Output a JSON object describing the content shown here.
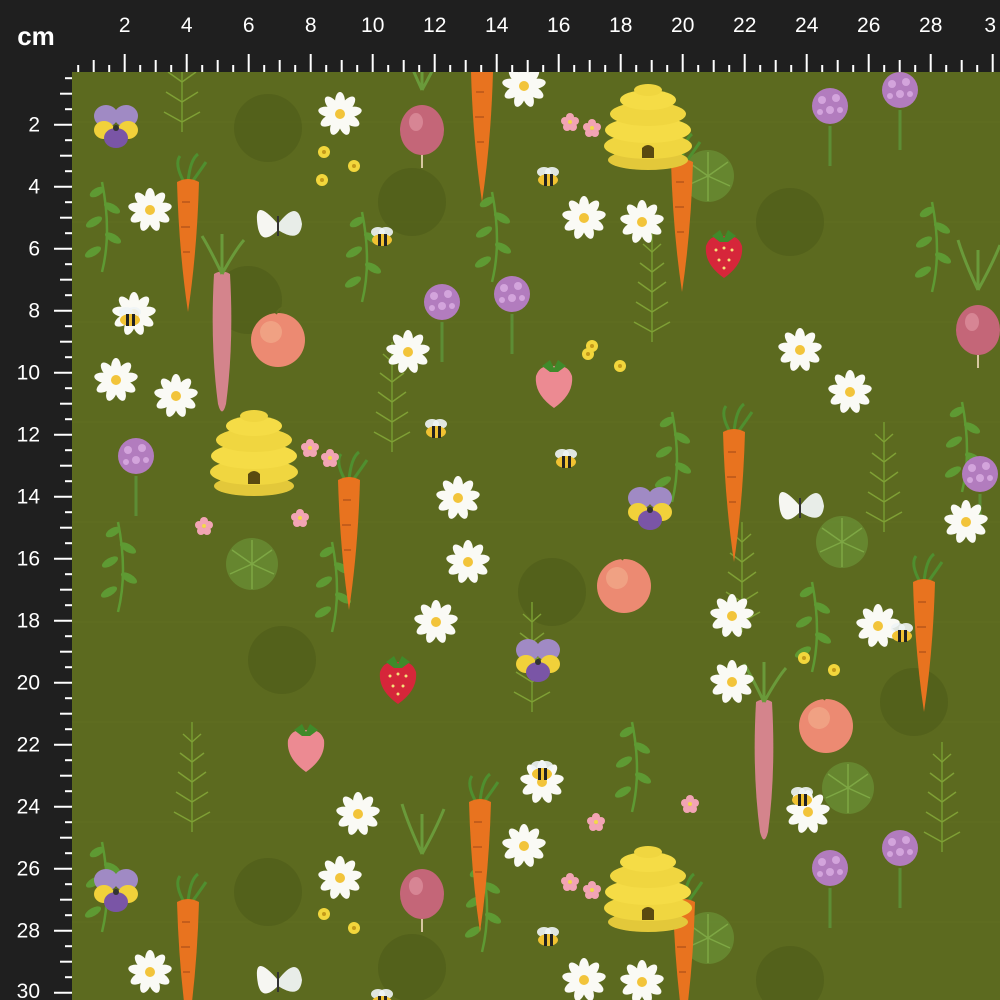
{
  "ruler": {
    "unit": "cm",
    "top_labels": [
      "2",
      "4",
      "6",
      "8",
      "10",
      "12",
      "14",
      "16",
      "18",
      "20",
      "22",
      "24",
      "26",
      "28",
      "3"
    ],
    "left_labels": [
      "2",
      "4",
      "6",
      "8",
      "10",
      "12",
      "14",
      "16",
      "18",
      "20",
      "22",
      "24",
      "26",
      "28",
      "30"
    ]
  },
  "fabric": {
    "background": "#5c6a1f",
    "motifs": [
      "carrot",
      "radish",
      "strawberry",
      "beehive",
      "bee",
      "daisy",
      "clover",
      "pansy",
      "butterfly",
      "peach",
      "leaf-sprig"
    ]
  }
}
